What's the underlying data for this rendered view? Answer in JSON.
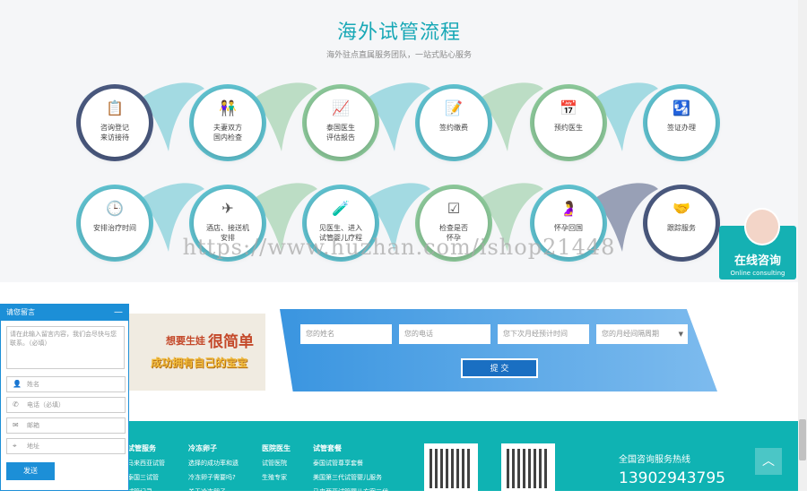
{
  "process": {
    "title": "海外试管流程",
    "subtitle": "海外驻点直属服务团队，一站式贴心服务",
    "row1": [
      {
        "label": "咨询登记\n来访接待",
        "icon": "clipboard-icon"
      },
      {
        "label": "夫妻双方\n国内检查",
        "icon": "couple-icon"
      },
      {
        "label": "泰国医生\n评估报告",
        "icon": "report-icon"
      },
      {
        "label": "签约缴费",
        "icon": "contract-icon"
      },
      {
        "label": "预约医生",
        "icon": "calendar-icon"
      },
      {
        "label": "签证办理",
        "icon": "passport-icon"
      }
    ],
    "row2": [
      {
        "label": "安排治疗时间",
        "icon": "clock-icon"
      },
      {
        "label": "酒店、接送机\n安排",
        "icon": "airplane-icon"
      },
      {
        "label": "见医生、进入\n试管婴儿疗程",
        "icon": "test-tube-icon"
      },
      {
        "label": "检查是否\n怀孕",
        "icon": "checklist-icon"
      },
      {
        "label": "怀孕回国",
        "icon": "pregnant-icon"
      },
      {
        "label": "跟踪服务",
        "icon": "follow-up-icon"
      }
    ]
  },
  "watermark": "https://www.huzhan.com/ishop21448",
  "consult": {
    "main": "在线咨询",
    "sub": "Online consulting"
  },
  "banner": {
    "t1": "想要生娃",
    "t2": "很简单",
    "t3": "成功拥有自己的宝宝"
  },
  "form": {
    "name_placeholder": "您的姓名",
    "phone_placeholder": "您的电话",
    "period_placeholder": "您下次月经预计时间",
    "cycle_placeholder": "您的月经间隔周期",
    "submit_label": "提 交"
  },
  "footer": {
    "cols": [
      {
        "heading": "试管服务",
        "items": [
          "马来西亚试管",
          "泰国三试管",
          "试管记录"
        ]
      },
      {
        "heading": "冷冻卵子",
        "items": [
          "选择的成功率和遗",
          "冷冻卵子需要吗?",
          "关于冷冻卵子"
        ]
      },
      {
        "heading": "医院医生",
        "items": [
          "试管医院",
          "生殖专家"
        ]
      },
      {
        "heading": "试管套餐",
        "items": [
          "泰国试管尊享套餐",
          "美国第三代试管婴儿服务",
          "马来西亚试管婴儿方案三代"
        ]
      }
    ],
    "hotline_label": "全国咨询服务热线",
    "hotline": "13902943795",
    "to_top": "︿"
  },
  "chat": {
    "title": "请您留言",
    "minimize": "—",
    "message_placeholder": "请在此输入留言内容，我们会尽快与您联系。（必填）",
    "fields": [
      {
        "label": "姓名",
        "icon": "person-icon"
      },
      {
        "label": "电话（必填）",
        "icon": "phone-icon"
      },
      {
        "label": "邮箱",
        "icon": "mail-icon"
      },
      {
        "label": "地址",
        "icon": "location-icon"
      }
    ],
    "send_label": "发送"
  },
  "colors": {
    "accent": "#18a8b6",
    "footer": "#0fb3b3",
    "chat": "#1c8fd7",
    "ring_dark": "#4b5a80",
    "ring_teal": "#5fc2d0",
    "ring_green": "#8cc99a"
  }
}
